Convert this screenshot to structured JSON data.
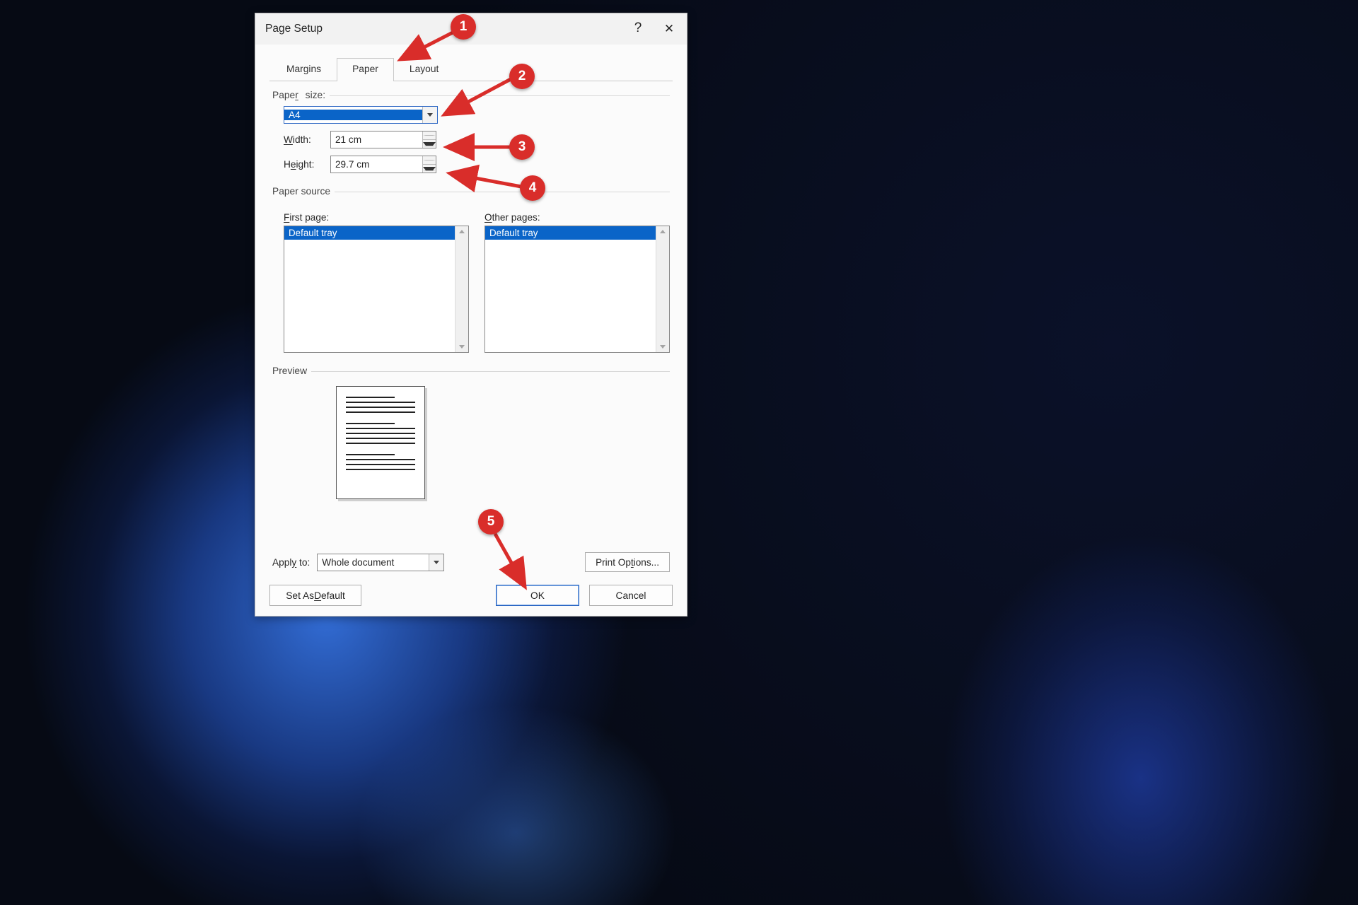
{
  "dialog": {
    "title": "Page Setup",
    "helpGlyph": "?",
    "closeGlyph": "✕"
  },
  "tabs": {
    "margins": "Margins",
    "paper": "Paper",
    "layout": "Layout"
  },
  "paperSize": {
    "label": "Paper size:",
    "value": "A4",
    "width": {
      "label": "Width:",
      "value": "21 cm"
    },
    "height": {
      "label": "Height:",
      "value": "29.7 cm"
    }
  },
  "paperSource": {
    "label": "Paper source",
    "firstPage": {
      "label": "First page:",
      "selected": "Default tray"
    },
    "otherPages": {
      "label": "Other pages:",
      "selected": "Default tray"
    }
  },
  "preview": {
    "label": "Preview"
  },
  "applyTo": {
    "label": "Apply to:",
    "value": "Whole document"
  },
  "buttons": {
    "printOptions": "Print Options...",
    "setDefault": "Set As Default",
    "ok": "OK",
    "cancel": "Cancel"
  },
  "callouts": {
    "c1": "1",
    "c2": "2",
    "c3": "3",
    "c4": "4",
    "c5": "5"
  }
}
